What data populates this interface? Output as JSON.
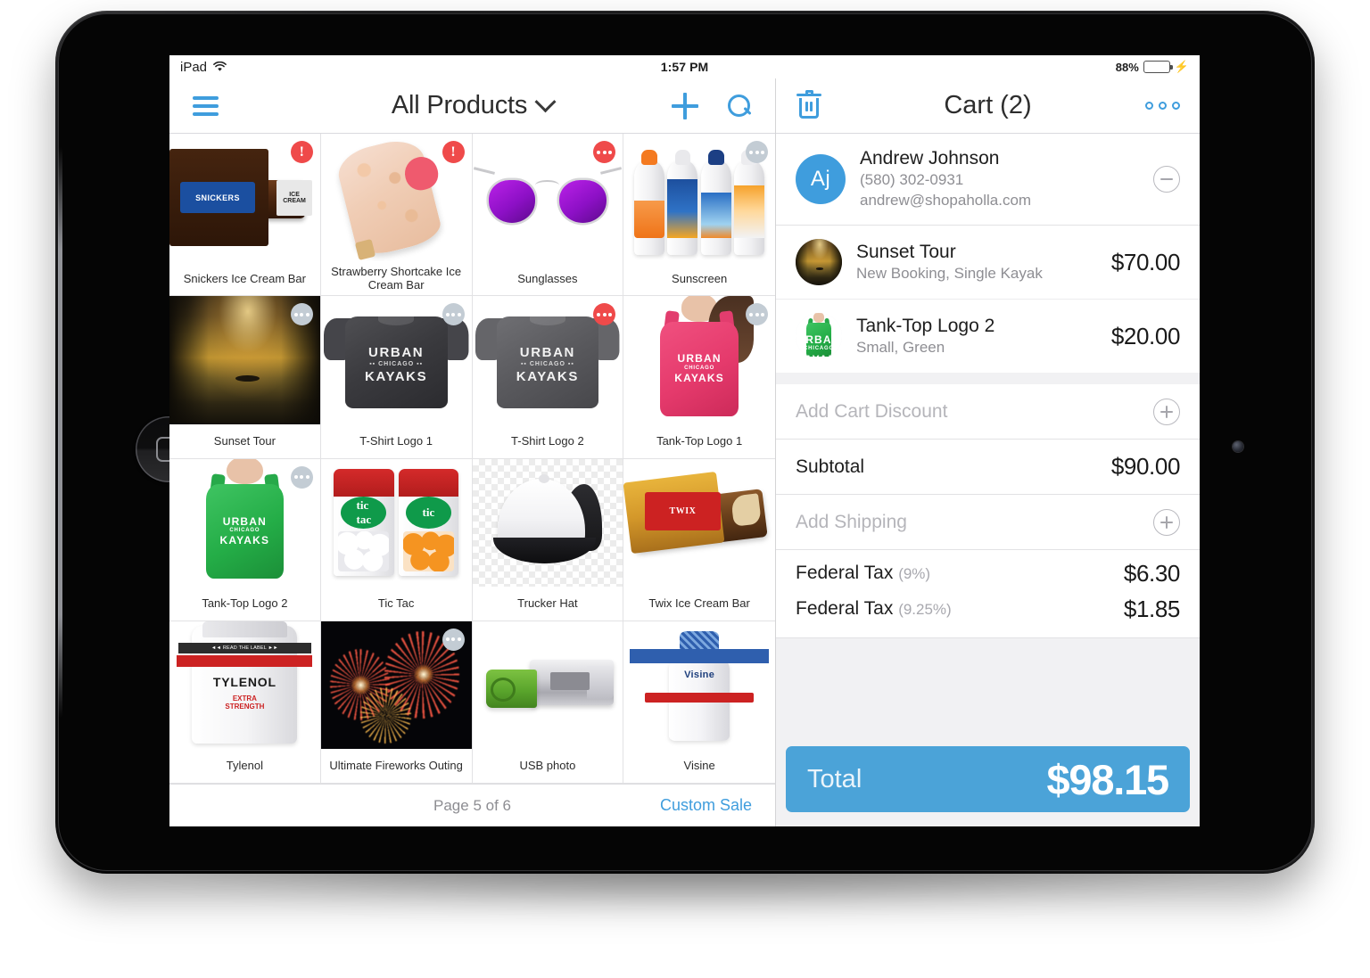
{
  "status_bar": {
    "device": "iPad",
    "wifi_icon": "wifi-icon",
    "time": "1:57 PM",
    "battery_percent": "88%",
    "battery_level": 88,
    "charging_icon": "lightning-bolt-icon"
  },
  "products_pane": {
    "menu_icon": "hamburger-menu-icon",
    "title": "All Products",
    "chevron_icon": "chevron-down-icon",
    "add_icon": "plus-icon",
    "search_icon": "search-icon",
    "products": [
      {
        "name": "Snickers Ice Cream Bar",
        "badge": "alert",
        "art": "snickers"
      },
      {
        "name": "Strawberry Shortcake Ice Cream Bar",
        "badge": "alert",
        "art": "shortcake"
      },
      {
        "name": "Sunglasses",
        "badge": "dots-red",
        "art": "sunglasses"
      },
      {
        "name": "Sunscreen",
        "badge": "dots-gray",
        "art": "sunscreen"
      },
      {
        "name": "Sunset Tour",
        "badge": "dots-gray",
        "art": "sunset"
      },
      {
        "name": "T-Shirt Logo 1",
        "badge": "dots-gray",
        "art": "shirt-dark"
      },
      {
        "name": "T-Shirt Logo 2",
        "badge": "dots-red",
        "art": "shirt-mid"
      },
      {
        "name": "Tank-Top Logo 1",
        "badge": "dots-gray",
        "art": "tank-pink"
      },
      {
        "name": "Tank-Top Logo 2",
        "badge": "dots-gray",
        "art": "tank-green"
      },
      {
        "name": "Tic Tac",
        "badge": "none",
        "art": "tictac"
      },
      {
        "name": "Trucker Hat",
        "badge": "none",
        "art": "hat"
      },
      {
        "name": "Twix Ice Cream Bar",
        "badge": "none",
        "art": "twix"
      },
      {
        "name": "Tylenol",
        "badge": "none",
        "art": "tylenol"
      },
      {
        "name": "Ultimate Fireworks Outing",
        "badge": "dots-gray",
        "art": "fireworks"
      },
      {
        "name": "USB photo",
        "badge": "none",
        "art": "usb"
      },
      {
        "name": "Visine",
        "badge": "none",
        "art": "visine"
      }
    ],
    "pager": {
      "page_text": "Page 5 of 6",
      "current_page": 5,
      "total_pages": 6,
      "custom_sale_label": "Custom Sale"
    }
  },
  "cart_pane": {
    "clear_icon": "trash-icon",
    "title": "Cart (2)",
    "item_count": 2,
    "more_icon": "more-options-icon",
    "customer": {
      "initials": "Aj",
      "name": "Andrew Johnson",
      "phone": "(580) 302-0931",
      "email": "andrew@shopaholla.com",
      "remove_icon": "minus-circle-icon"
    },
    "line_items": [
      {
        "name": "Sunset Tour",
        "variant": "New Booking, Single Kayak",
        "price": "$70.00",
        "art": "sunset"
      },
      {
        "name": "Tank-Top Logo 2",
        "variant": "Small, Green",
        "price": "$20.00",
        "art": "tank-green"
      }
    ],
    "discount_row": {
      "label": "Add Cart Discount",
      "add_icon": "plus-circle-icon"
    },
    "subtotal_row": {
      "label": "Subtotal",
      "value": "$90.00"
    },
    "shipping_row": {
      "label": "Add Shipping",
      "add_icon": "plus-circle-icon"
    },
    "taxes": [
      {
        "label": "Federal Tax",
        "rate": "(9%)",
        "value": "$6.30"
      },
      {
        "label": "Federal Tax",
        "rate": "(9.25%)",
        "value": "$1.85"
      }
    ],
    "total": {
      "label": "Total",
      "value": "$98.15"
    }
  },
  "colors": {
    "accent_blue": "#3f9ddd",
    "total_bar_blue": "#4ba3d8",
    "badge_red": "#ef4a4a",
    "badge_gray": "#c3ccd4",
    "battery_green": "#38d13a",
    "muted_text": "#8e8e93",
    "panel_bg": "#f1f1f3"
  }
}
